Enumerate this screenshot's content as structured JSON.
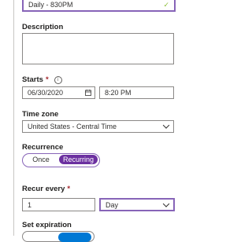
{
  "schedule": {
    "value": "Daily - 830PM"
  },
  "description": {
    "label": "Description",
    "value": ""
  },
  "starts": {
    "label": "Starts",
    "required_mark": "*",
    "date": "06/30/2020",
    "time": "8:20 PM"
  },
  "timezone": {
    "label": "Time zone",
    "value": "United States - Central Time"
  },
  "recurrence": {
    "label": "Recurrence",
    "options": [
      "Once",
      "Recurring"
    ],
    "selected": "Recurring"
  },
  "recur_every": {
    "label": "Recur every",
    "required_mark": "*",
    "number": "1",
    "unit": "Day"
  },
  "expiration": {
    "label": "Set expiration"
  },
  "colors": {
    "accent": "#8764b8",
    "toggle_on": "#6b2fa0",
    "required": "#a4262c",
    "valid": "#8fbf3a",
    "expiration_toggle": "#0078d4"
  }
}
